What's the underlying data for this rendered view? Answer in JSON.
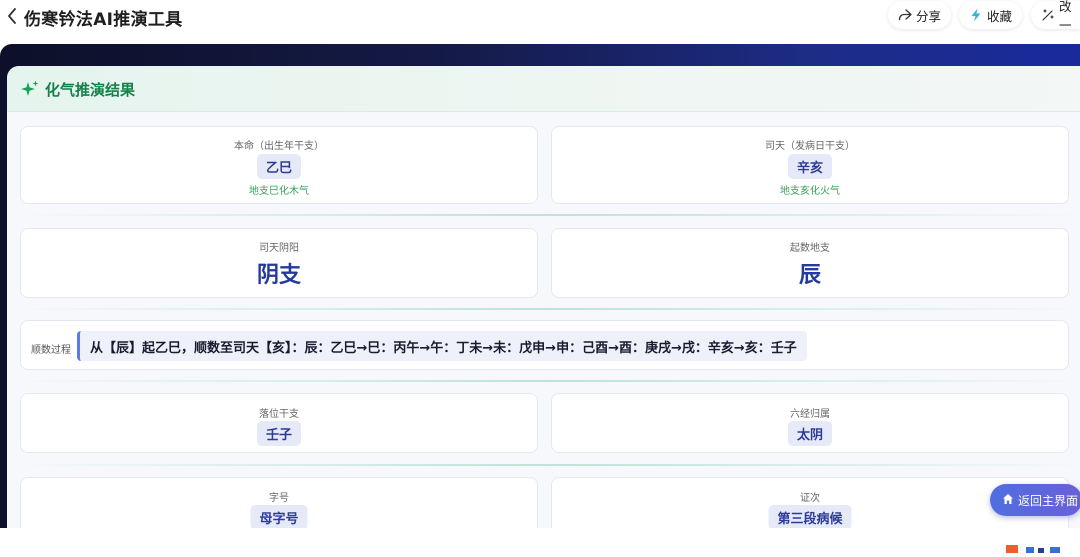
{
  "header": {
    "title": "伤寒钤法AI推演工具",
    "share_label": "分享",
    "favorite_label": "收藏",
    "edit_label": "改一"
  },
  "result": {
    "title": "化气推演结果",
    "benming": {
      "label": "本命（出生年干支）",
      "value": "乙巳",
      "note": "地支巳化木气"
    },
    "sitian": {
      "label": "司天（发病日干支）",
      "value": "辛亥",
      "note": "地支亥化火气"
    },
    "sitian_yinyang": {
      "label": "司天阴阳",
      "value": "阴支"
    },
    "qishu_dizhi": {
      "label": "起数地支",
      "value": "辰"
    },
    "process": {
      "label": "顺数过程",
      "value": "从【辰】起乙巳，顺数至司天【亥】：辰：乙巳→巳：丙午→午：丁未→未：戊申→申：己酉→酉：庚戌→戌：辛亥→亥：壬子"
    },
    "luowei_ganzhi": {
      "label": "落位干支",
      "value": "壬子"
    },
    "liujing_guishu": {
      "label": "六经归属",
      "value": "太阴"
    },
    "zihao": {
      "label": "字号",
      "value": "母字号"
    },
    "zhengci": {
      "label": "证次",
      "value": "第三段病候"
    }
  },
  "home_button": {
    "label": "返回主界面"
  },
  "colors": {
    "accent_green": "#16804a",
    "accent_blue": "#243a9c",
    "chip_bg": "#e6e9f8",
    "note_green": "#33a35a"
  }
}
